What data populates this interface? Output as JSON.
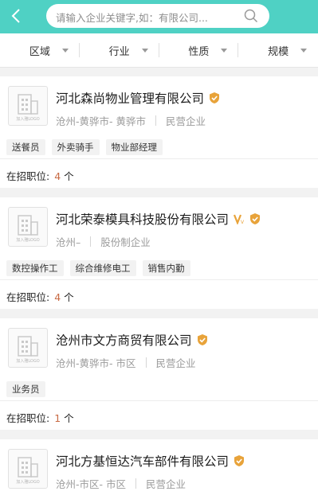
{
  "search": {
    "placeholder": "请输入企业关键字,如：有限公司..."
  },
  "filters": [
    "区域",
    "行业",
    "性质",
    "规模"
  ],
  "companies": [
    {
      "logo_text": "加入雅LOGO",
      "name": "河北森尚物业管理有限公司",
      "location": "沧州-黄骅市- 黄骅市",
      "type": "民营企业",
      "badges": [
        "verified-shield"
      ],
      "tags": [
        "送餐员",
        "外卖骑手",
        "物业部经理"
      ],
      "jobs_label": "在招职位:",
      "jobs_count": "4",
      "jobs_unit": "个"
    },
    {
      "logo_text": "加入雅LOGO",
      "name": "河北荣泰模具科技股份有限公司",
      "location": "沧州–",
      "type": "股份制企业",
      "badges": [
        "vip-badge",
        "verified-shield"
      ],
      "tags": [
        "数控操作工",
        "综合维修电工",
        "销售内勤"
      ],
      "jobs_label": "在招职位:",
      "jobs_count": "4",
      "jobs_unit": "个"
    },
    {
      "logo_text": "加入雅LOGO",
      "name": "沧州市文方商贸有限公司",
      "location": "沧州-黄骅市- 市区",
      "type": "民营企业",
      "badges": [
        "verified-shield"
      ],
      "tags": [
        "业务员"
      ],
      "jobs_label": "在招职位:",
      "jobs_count": "1",
      "jobs_unit": "个"
    },
    {
      "logo_text": "加入雅LOGO",
      "name": "河北方基恒达汽车部件有限公司",
      "location": "沧州-市区- 市区",
      "type": "民营企业",
      "badges": [
        "verified-shield"
      ],
      "tags": [],
      "jobs_label": "",
      "jobs_count": "",
      "jobs_unit": ""
    }
  ],
  "colors": {
    "header": "#4fd1c4",
    "accent_count": "#c86a43",
    "shield": "#e8a33a"
  }
}
